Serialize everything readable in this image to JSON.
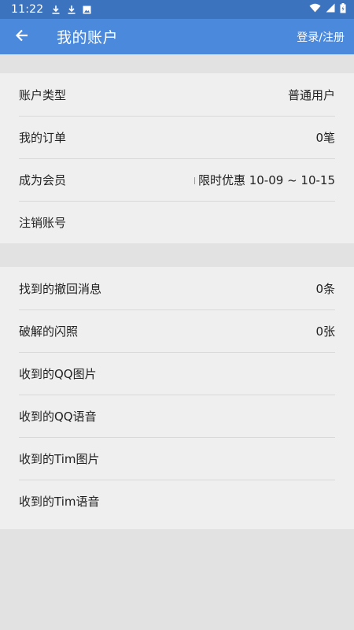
{
  "status_bar": {
    "time": "11:22",
    "left_icons": [
      "download-icon",
      "download-icon",
      "photo-icon"
    ],
    "right_icons": [
      "wifi-icon",
      "signal-icon",
      "battery-icon"
    ],
    "color": "#3b73bf"
  },
  "app_bar": {
    "back_icon": "arrow-left-icon",
    "title": "我的账户",
    "login_label": "登录/注册",
    "color": "#4a89dc"
  },
  "account_section": {
    "rows": [
      {
        "label": "账户类型",
        "value": "普通用户"
      },
      {
        "label": "我的订单",
        "value": "0笔"
      },
      {
        "label": "成为会员",
        "value": "限时优惠 10-09 ~ 10-15"
      },
      {
        "label": "注销账号",
        "value": ""
      }
    ]
  },
  "records_section": {
    "rows": [
      {
        "label": "找到的撤回消息",
        "value": "0条"
      },
      {
        "label": "破解的闪照",
        "value": "0张"
      },
      {
        "label": "收到的QQ图片",
        "value": ""
      },
      {
        "label": "收到的QQ语音",
        "value": ""
      },
      {
        "label": "收到的Tim图片",
        "value": ""
      },
      {
        "label": "收到的Tim语音",
        "value": ""
      }
    ]
  }
}
